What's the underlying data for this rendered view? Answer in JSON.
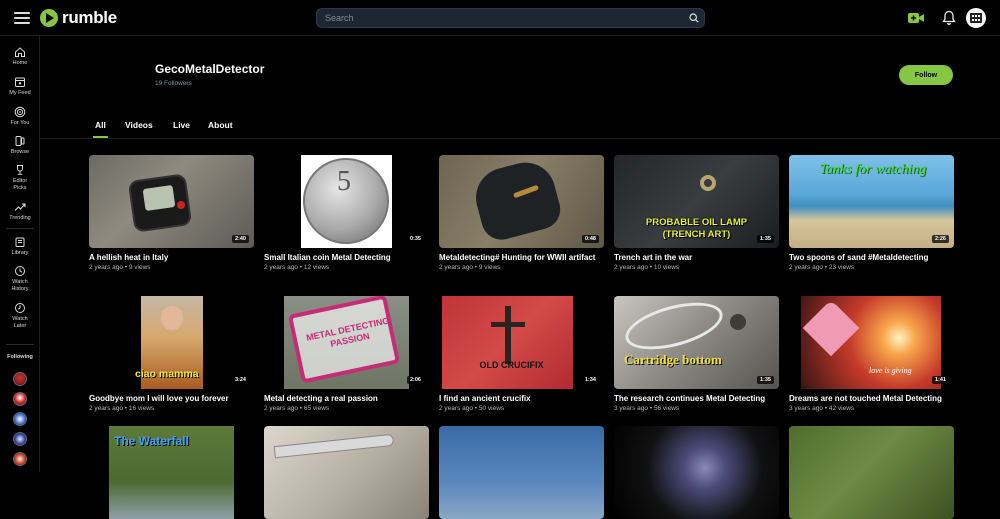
{
  "brand": {
    "name": "rumble",
    "accent": "#85c742"
  },
  "search": {
    "placeholder": "Search"
  },
  "sidebar": {
    "items": [
      {
        "label": "Home",
        "icon": "home-icon"
      },
      {
        "label": "My Feed",
        "icon": "feed-icon"
      },
      {
        "label": "For You",
        "icon": "target-icon"
      },
      {
        "label": "Browse",
        "icon": "browse-icon"
      },
      {
        "label": "Editor Picks",
        "icon": "trophy-icon"
      },
      {
        "label": "Trending",
        "icon": "trending-icon"
      },
      {
        "label": "Library",
        "icon": "library-icon"
      },
      {
        "label": "Watch History",
        "icon": "history-icon"
      },
      {
        "label": "Watch Later",
        "icon": "clock-icon"
      }
    ],
    "following_label": "Following"
  },
  "channel": {
    "name": "GecoMetalDetector",
    "followers": "19 Followers",
    "follow_label": "Follow"
  },
  "tabs": [
    "All",
    "Videos",
    "Live",
    "About"
  ],
  "videos": [
    {
      "title": "A hellish heat in Italy",
      "meta": "2 years ago • 9 views",
      "duration": "2:40"
    },
    {
      "title": "Small Italian coin Metal Detecting",
      "meta": "2 years ago • 12 views",
      "duration": "0:35",
      "overlay": "5"
    },
    {
      "title": "Metaldetecting# Hunting for WWII artifact",
      "meta": "2 years ago • 9 views",
      "duration": "0:48"
    },
    {
      "title": "Trench art in the war",
      "meta": "2 years ago • 10 views",
      "duration": "1:35",
      "overlay": "PROBABLE OIL LAMP (TRENCH ART)"
    },
    {
      "title": "Two spoons of sand #Metaldetecting",
      "meta": "2 years ago • 23 views",
      "duration": "2:26",
      "overlay": "Tanks for watching"
    },
    {
      "title": "Goodbye mom I will love you forever",
      "meta": "2 years ago • 16 views",
      "duration": "3:24",
      "overlay": "ciao mamma"
    },
    {
      "title": "Metal detecting a real passion",
      "meta": "2 years ago • 65 views",
      "duration": "2:06",
      "overlay": "METAL DETECTING PASSION"
    },
    {
      "title": "I find an ancient crucifix",
      "meta": "2 years ago • 50 views",
      "duration": "1:34",
      "overlay": "OLD CRUCIFIX"
    },
    {
      "title": "The research continues Metal Detecting",
      "meta": "3 years ago • 56 views",
      "duration": "1:35",
      "overlay": "Cartridge bottom"
    },
    {
      "title": "Dreams are not touched Metal Detecting",
      "meta": "3 years ago • 42 views",
      "duration": "1:41",
      "overlay": "love is giving"
    },
    {
      "title": "",
      "meta": "",
      "duration": "",
      "overlay": "The Waterfall"
    },
    {
      "title": "",
      "meta": "",
      "duration": ""
    },
    {
      "title": "",
      "meta": "",
      "duration": ""
    },
    {
      "title": "",
      "meta": "",
      "duration": ""
    },
    {
      "title": "",
      "meta": "",
      "duration": ""
    }
  ]
}
